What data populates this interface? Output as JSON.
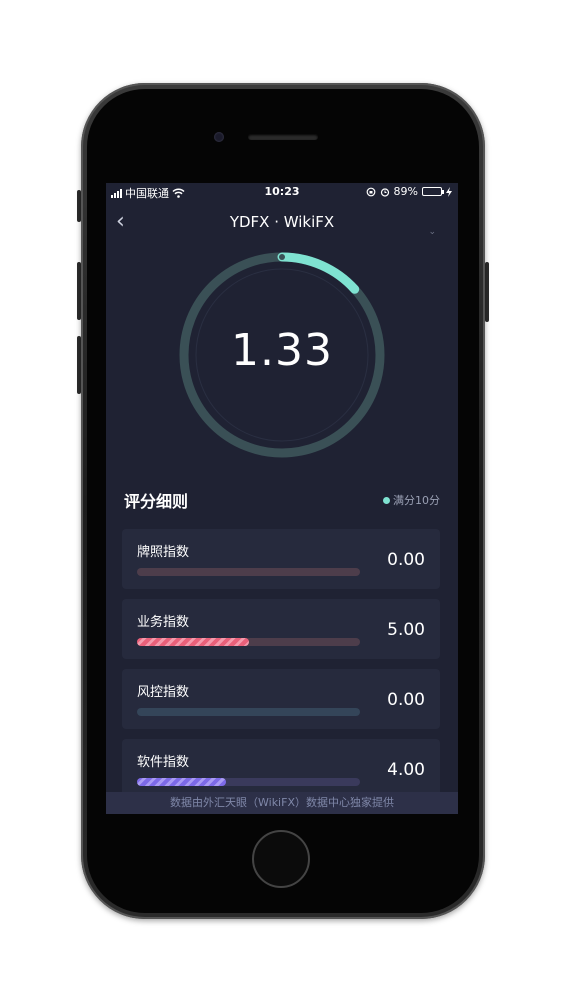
{
  "status_bar": {
    "carrier": "中国联通",
    "time": "10:23",
    "battery_percent": "89%",
    "battery_level": 0.89
  },
  "nav": {
    "title": "YDFX  · WikiFX",
    "back_icon": "chevron-left-icon"
  },
  "gauge": {
    "value": "1.33",
    "score": 1.33,
    "max": 10,
    "track_color": "#3a5056",
    "arc_color": "#7fe2d1"
  },
  "section": {
    "title": "评分细则",
    "legend": "满分10分"
  },
  "metrics": [
    {
      "label": "牌照指数",
      "value": "0.00",
      "score": 0.0,
      "track_color": "#4d3d4b",
      "fill_style": "none"
    },
    {
      "label": "业务指数",
      "value": "5.00",
      "score": 5.0,
      "track_color": "#4d3d4b",
      "fill_style": "red"
    },
    {
      "label": "风控指数",
      "value": "0.00",
      "score": 0.0,
      "track_color": "#344559",
      "fill_style": "none"
    },
    {
      "label": "软件指数",
      "value": "4.00",
      "score": 4.0,
      "track_color": "#3a3a5c",
      "fill_style": "purple"
    }
  ],
  "footer": {
    "text": "数据由外汇天眼（WikiFX）数据中心独家提供"
  }
}
